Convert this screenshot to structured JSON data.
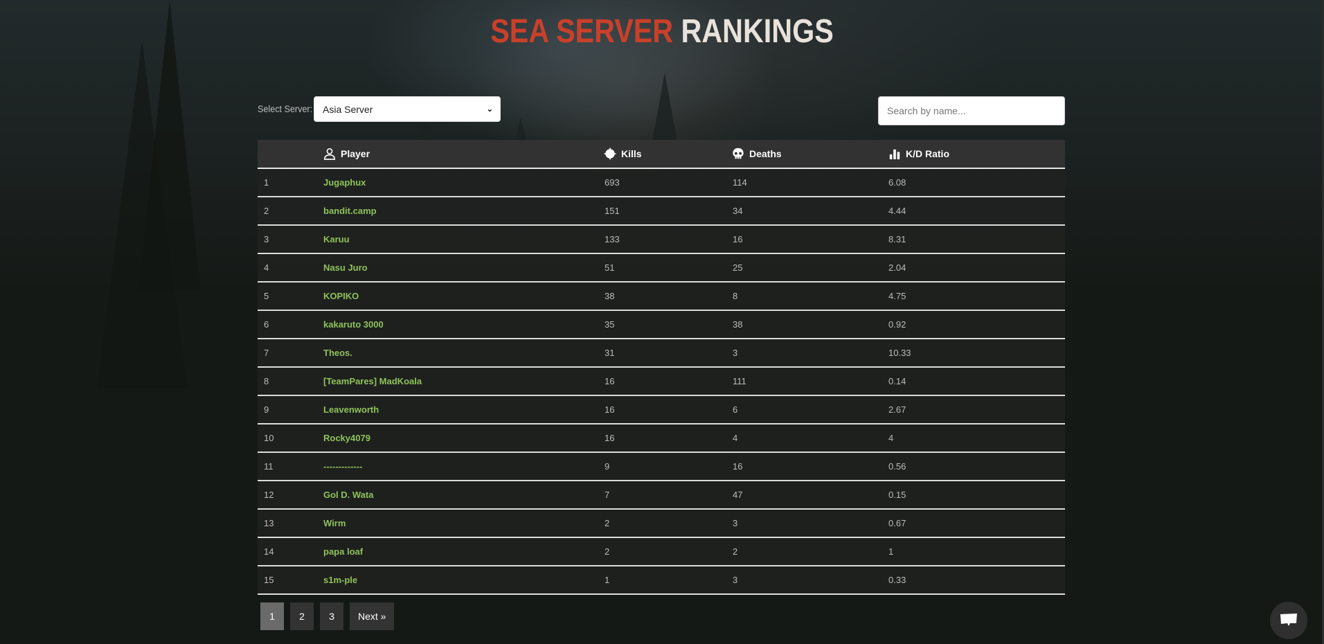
{
  "header": {
    "title_part1": "SEA SERVER",
    "title_part2": "RANKINGS",
    "accent_color": "#c9402a"
  },
  "controls": {
    "select_label": "Select Server:",
    "selected_server": "Asia Server",
    "search_placeholder": "Search by name...",
    "search_value": ""
  },
  "table": {
    "columns": [
      {
        "label": "",
        "icon": ""
      },
      {
        "label": "Player",
        "icon": "user-icon"
      },
      {
        "label": "Kills",
        "icon": "crosshairs-icon"
      },
      {
        "label": "Deaths",
        "icon": "skull-icon"
      },
      {
        "label": "K/D Ratio",
        "icon": "chart-bar-icon"
      }
    ],
    "rows": [
      {
        "rank": "1",
        "player": "Jugaphux",
        "kills": "693",
        "deaths": "114",
        "kd": "6.08"
      },
      {
        "rank": "2",
        "player": "bandit.camp",
        "kills": "151",
        "deaths": "34",
        "kd": "4.44"
      },
      {
        "rank": "3",
        "player": "Karuu",
        "kills": "133",
        "deaths": "16",
        "kd": "8.31"
      },
      {
        "rank": "4",
        "player": "Nasu Juro",
        "kills": "51",
        "deaths": "25",
        "kd": "2.04"
      },
      {
        "rank": "5",
        "player": "KOPIKO",
        "kills": "38",
        "deaths": "8",
        "kd": "4.75"
      },
      {
        "rank": "6",
        "player": "kakaruto 3000",
        "kills": "35",
        "deaths": "38",
        "kd": "0.92"
      },
      {
        "rank": "7",
        "player": "Theos.",
        "kills": "31",
        "deaths": "3",
        "kd": "10.33"
      },
      {
        "rank": "8",
        "player": "[TeamPares] MadKoala",
        "kills": "16",
        "deaths": "111",
        "kd": "0.14"
      },
      {
        "rank": "9",
        "player": "Leavenworth",
        "kills": "16",
        "deaths": "6",
        "kd": "2.67"
      },
      {
        "rank": "10",
        "player": "Rocky4079",
        "kills": "16",
        "deaths": "4",
        "kd": "4"
      },
      {
        "rank": "11",
        "player": "-------------",
        "kills": "9",
        "deaths": "16",
        "kd": "0.56"
      },
      {
        "rank": "12",
        "player": "Gol D. Wata",
        "kills": "7",
        "deaths": "47",
        "kd": "0.15"
      },
      {
        "rank": "13",
        "player": "Wirm",
        "kills": "2",
        "deaths": "3",
        "kd": "0.67"
      },
      {
        "rank": "14",
        "player": "papa loaf",
        "kills": "2",
        "deaths": "2",
        "kd": "1"
      },
      {
        "rank": "15",
        "player": "s1m-ple",
        "kills": "1",
        "deaths": "3",
        "kd": "0.33"
      }
    ]
  },
  "pagination": {
    "pages": [
      "1",
      "2",
      "3"
    ],
    "current": "1",
    "next_label": "Next »"
  },
  "chat": {
    "icon": "chat-bubble-icon"
  }
}
